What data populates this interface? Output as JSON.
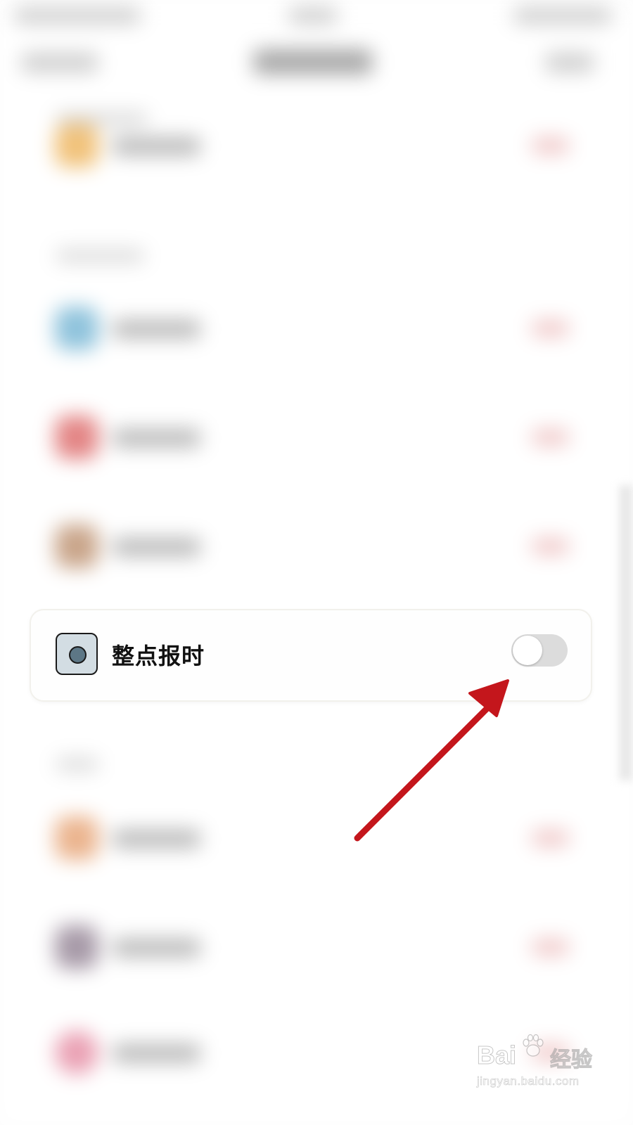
{
  "settings_item": {
    "label": "整点报时",
    "toggle_on": false
  },
  "watermark": {
    "brand": "Bai",
    "brand_cn": "经验",
    "url": "jingyan.baidu.com"
  },
  "colors": {
    "annotation_arrow": "#c4161c",
    "toggle_off_track": "#dcdcdc",
    "icon_fill": "#d3dde3",
    "icon_dot": "#5d7786"
  }
}
